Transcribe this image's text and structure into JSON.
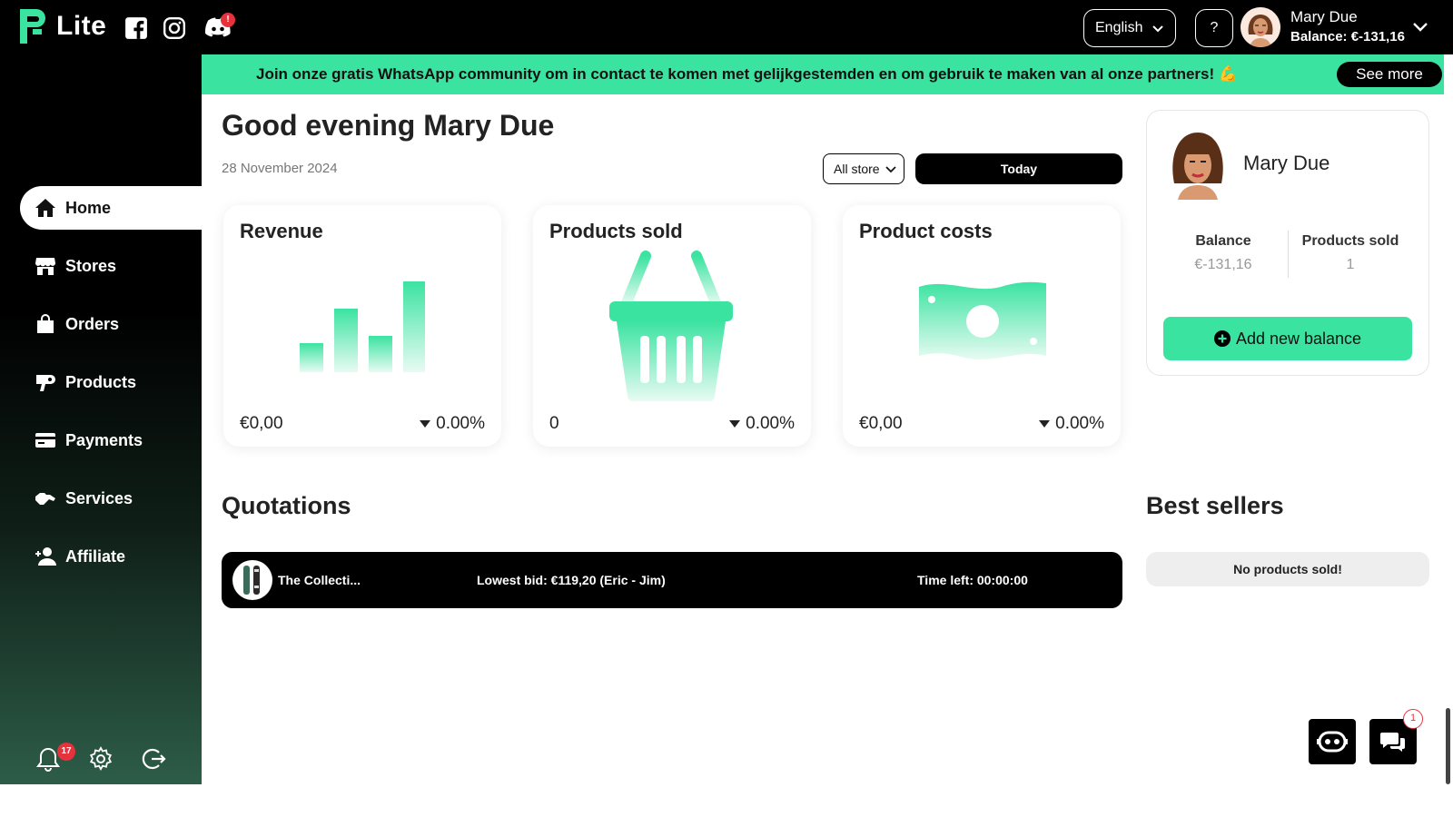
{
  "app": {
    "name": "Lite"
  },
  "topbar": {
    "language": "English",
    "help_label": "?",
    "discord_badge": "!",
    "user_name": "Mary Due",
    "user_balance": "Balance: €-131,16"
  },
  "banner": {
    "text": "Join onze gratis WhatsApp community om in contact te komen met gelijkgestemden en om gebruik te maken van al onze partners! 💪",
    "button": "See more"
  },
  "sidebar": {
    "items": [
      {
        "label": "Home",
        "icon": "home-icon"
      },
      {
        "label": "Stores",
        "icon": "store-icon"
      },
      {
        "label": "Orders",
        "icon": "bag-icon"
      },
      {
        "label": "Products",
        "icon": "hairdryer-icon"
      },
      {
        "label": "Payments",
        "icon": "card-icon"
      },
      {
        "label": "Services",
        "icon": "handshake-icon"
      },
      {
        "label": "Affiliate",
        "icon": "user-plus-icon"
      }
    ],
    "notification_count": "17"
  },
  "main": {
    "greeting": "Good evening Mary Due",
    "date": "28 November 2024",
    "store_filter": "All store",
    "period_button": "Today"
  },
  "cards": [
    {
      "title": "Revenue",
      "value": "€0,00",
      "change": "0.00%"
    },
    {
      "title": "Products sold",
      "value": "0",
      "change": "0.00%"
    },
    {
      "title": "Product costs",
      "value": "€0,00",
      "change": "0.00%"
    }
  ],
  "profile": {
    "name": "Mary Due",
    "balance_label": "Balance",
    "balance_value": "€-131,16",
    "sold_label": "Products sold",
    "sold_value": "1",
    "add_button": "Add new balance"
  },
  "quotations": {
    "title": "Quotations",
    "rows": [
      {
        "product": "The Collecti...",
        "bid": "Lowest bid: €119,20 (Eric - Jim)",
        "time": "Time left: 00:00:00"
      }
    ]
  },
  "best_sellers": {
    "title": "Best sellers",
    "empty_text": "No products sold!"
  },
  "chat": {
    "badge": "1"
  },
  "colors": {
    "accent": "#3be3a1",
    "dark": "#000000",
    "badge": "#e5323c"
  }
}
